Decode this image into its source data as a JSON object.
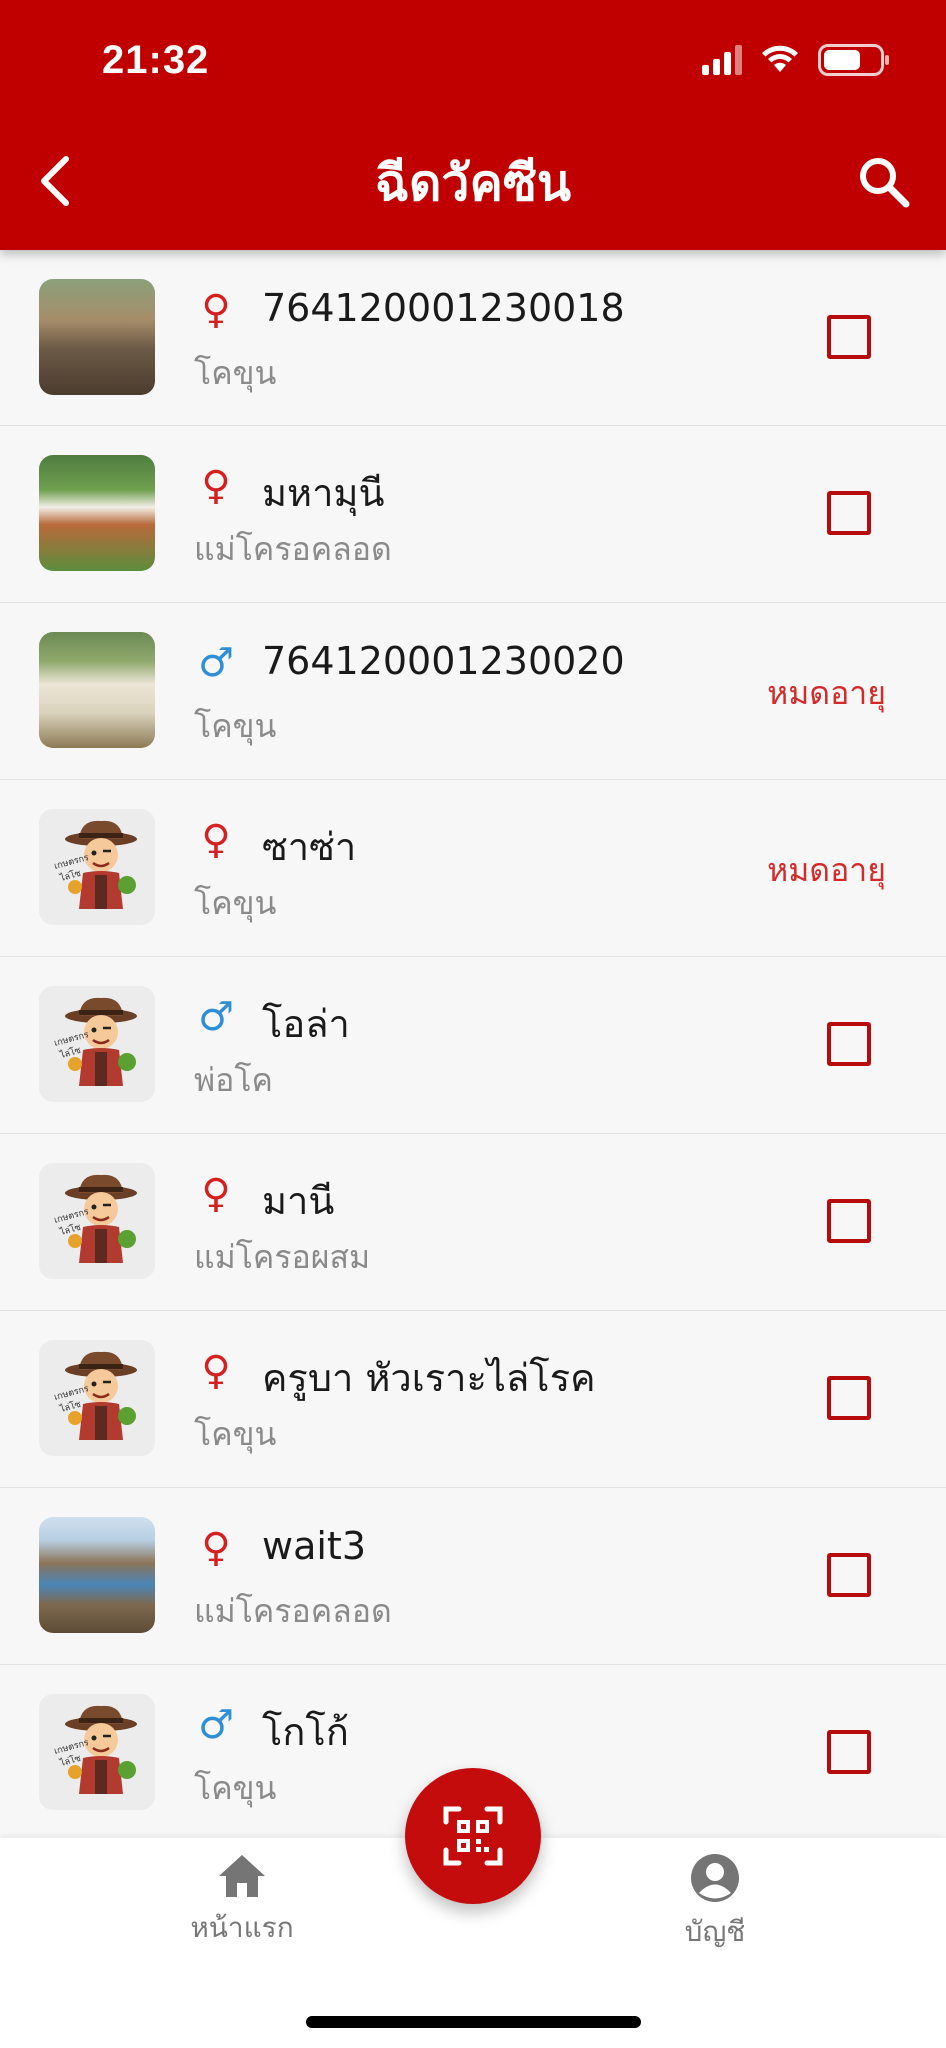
{
  "status_bar": {
    "time": "21:32"
  },
  "header": {
    "title": "ฉีดวัคซีน"
  },
  "colors": {
    "brand": "#c00000",
    "female": "#d42020",
    "male": "#2f8fd6",
    "expired": "#d32a2a"
  },
  "animals": [
    {
      "name": "764120001230018",
      "type": "โคขุน",
      "sex": "female",
      "sex_symbol": "♀",
      "thumbnail": "photo",
      "status": "checkbox"
    },
    {
      "name": "มหามุนี",
      "type": "แม่โครอคลอด",
      "sex": "female",
      "sex_symbol": "♀",
      "thumbnail": "photo",
      "status": "checkbox"
    },
    {
      "name": "764120001230020",
      "type": "โคขุน",
      "sex": "male",
      "sex_symbol": "♂",
      "thumbnail": "photo",
      "status": "expired",
      "status_label": "หมดอายุ"
    },
    {
      "name": "ซาซ่า",
      "type": "โคขุน",
      "sex": "female",
      "sex_symbol": "♀",
      "thumbnail": "avatar",
      "status": "expired",
      "status_label": "หมดอายุ"
    },
    {
      "name": "โอล่า",
      "type": "พ่อโค",
      "sex": "male",
      "sex_symbol": "♂",
      "thumbnail": "avatar",
      "status": "checkbox"
    },
    {
      "name": "มานี",
      "type": "แม่โครอผสม",
      "sex": "female",
      "sex_symbol": "♀",
      "thumbnail": "avatar",
      "status": "checkbox"
    },
    {
      "name": "ครูบา  หัวเราะไล่โรค",
      "type": "โคขุน",
      "sex": "female",
      "sex_symbol": "♀",
      "thumbnail": "avatar",
      "status": "checkbox"
    },
    {
      "name": "wait3",
      "type": "แม่โครอคลอด",
      "sex": "female",
      "sex_symbol": "♀",
      "thumbnail": "photo",
      "status": "checkbox"
    },
    {
      "name": "โกโก้",
      "type": "โคขุน",
      "sex": "male",
      "sex_symbol": "♂",
      "thumbnail": "avatar",
      "status": "checkbox"
    }
  ],
  "bottom_nav": {
    "home_label": "หน้าแรก",
    "account_label": "บัญชี",
    "home_icon": "home-icon",
    "account_icon": "account-icon",
    "scan_icon": "qr-scan-icon"
  }
}
